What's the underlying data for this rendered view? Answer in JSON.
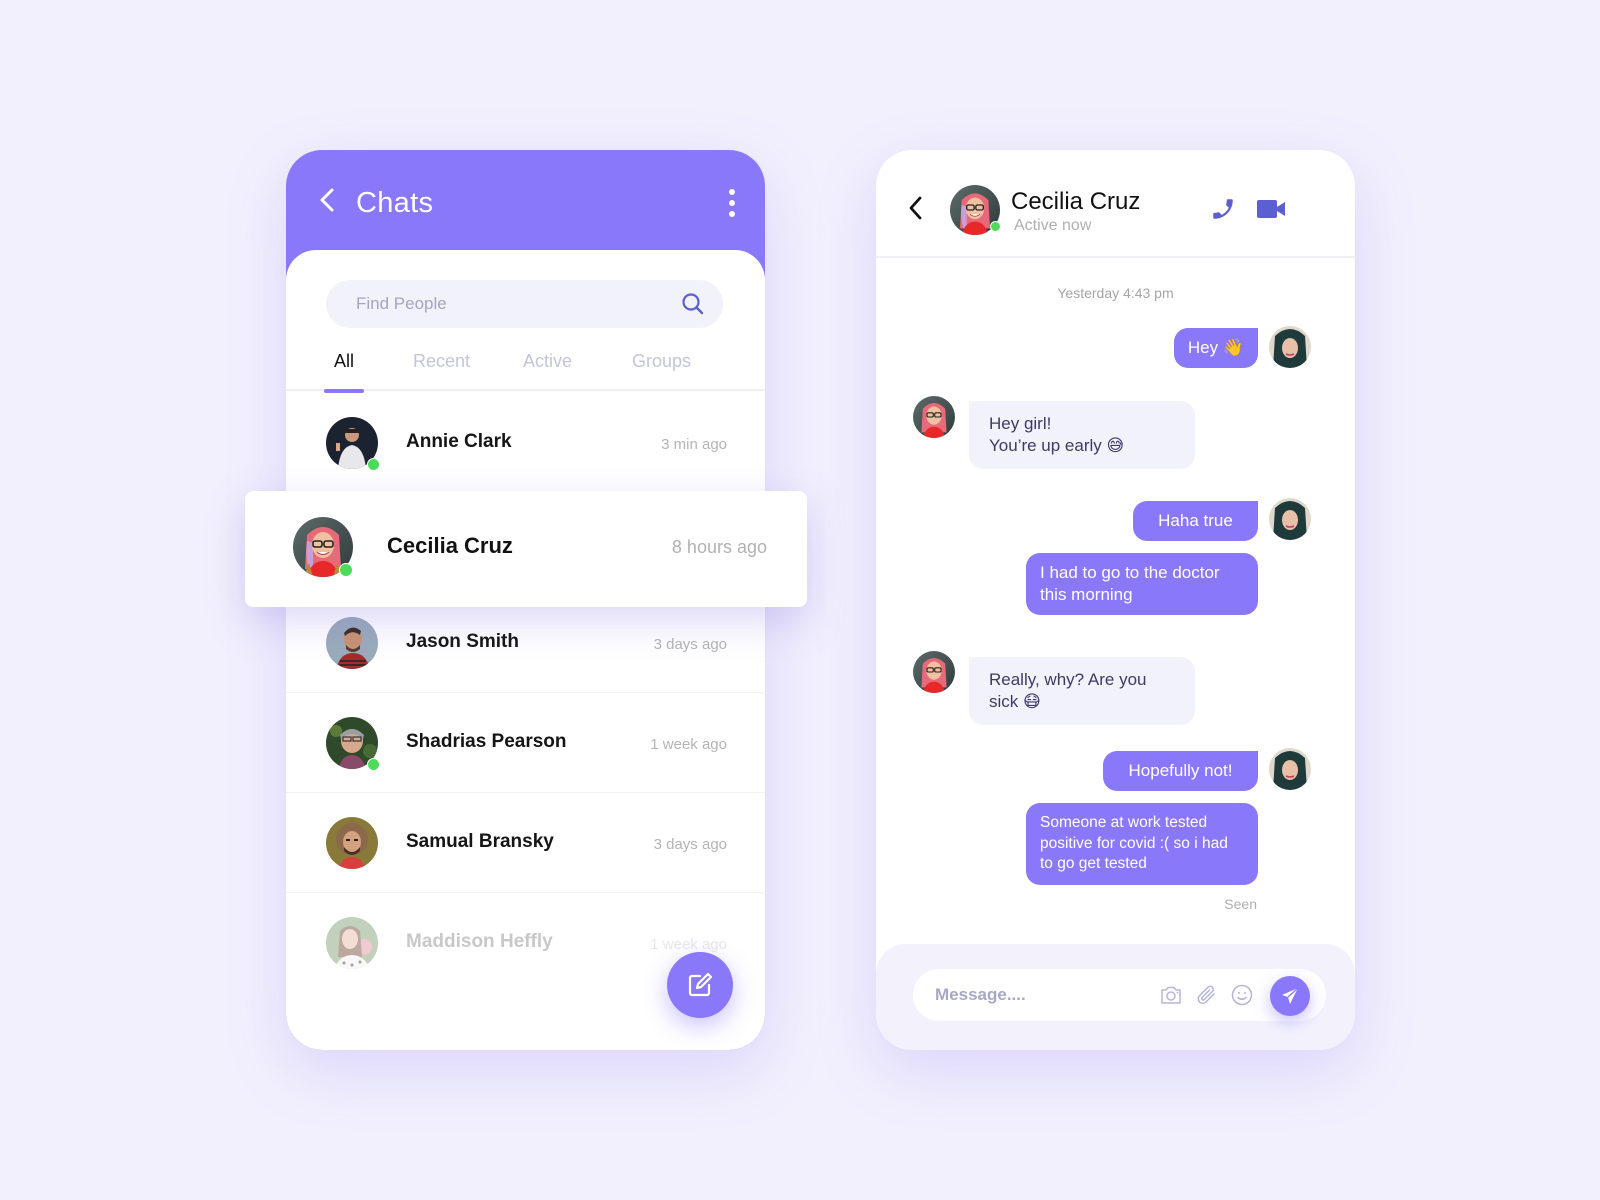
{
  "colors": {
    "accent": "#8a78fa",
    "online": "#4ddb5a",
    "background": "#f2f0fd",
    "icon_blue": "#5b5fcf"
  },
  "chats": {
    "header": {
      "back_icon": "chevron-left-icon",
      "title": "Chats",
      "menu_icon": "more-vertical-icon"
    },
    "search": {
      "placeholder": "Find People",
      "value": "",
      "icon": "search-icon"
    },
    "tabs": [
      {
        "label": "All",
        "active": true
      },
      {
        "label": "Recent",
        "active": false
      },
      {
        "label": "Active",
        "active": false
      },
      {
        "label": "Groups",
        "active": false
      }
    ],
    "contacts": [
      {
        "name": "Annie Clark",
        "time": "3 min ago",
        "online": true
      },
      {
        "name": "Cecilia Cruz",
        "time": "8 hours ago",
        "online": true,
        "highlighted": true
      },
      {
        "name": "Jason Smith",
        "time": "3 days ago",
        "online": false
      },
      {
        "name": "Shadrias Pearson",
        "time": "1 week ago",
        "online": true
      },
      {
        "name": "Samual Bransky",
        "time": "3 days ago",
        "online": false
      },
      {
        "name": "Maddison Heffly",
        "time": "1 week ago",
        "online": false,
        "faded": true
      }
    ],
    "fab_icon": "compose-icon"
  },
  "conversation": {
    "header": {
      "back_icon": "chevron-left-icon",
      "name": "Cecilia Cruz",
      "status": "Active now",
      "call_icon": "phone-icon",
      "video_icon": "video-camera-icon",
      "menu_icon": "more-vertical-icon"
    },
    "date_stamp": "Yesterday 4:43 pm",
    "messages": [
      {
        "from": "me",
        "text": "Hey 👋"
      },
      {
        "from": "them",
        "line1": "Hey girl!",
        "line2": "You’re up early 😅"
      },
      {
        "from": "me",
        "text": "Haha true"
      },
      {
        "from": "me",
        "text": "I had to go to the doctor this morning"
      },
      {
        "from": "them",
        "text": "Really, why? Are you sick 😷"
      },
      {
        "from": "me",
        "text": "Hopefully not!"
      },
      {
        "from": "me",
        "text": "Someone at work tested positive for covid :( so i had to go get tested"
      }
    ],
    "seen_label": "Seen",
    "composer": {
      "placeholder": "Message....",
      "value": "",
      "icons": [
        "camera-icon",
        "paperclip-icon",
        "emoji-icon"
      ],
      "send_icon": "send-icon"
    }
  }
}
